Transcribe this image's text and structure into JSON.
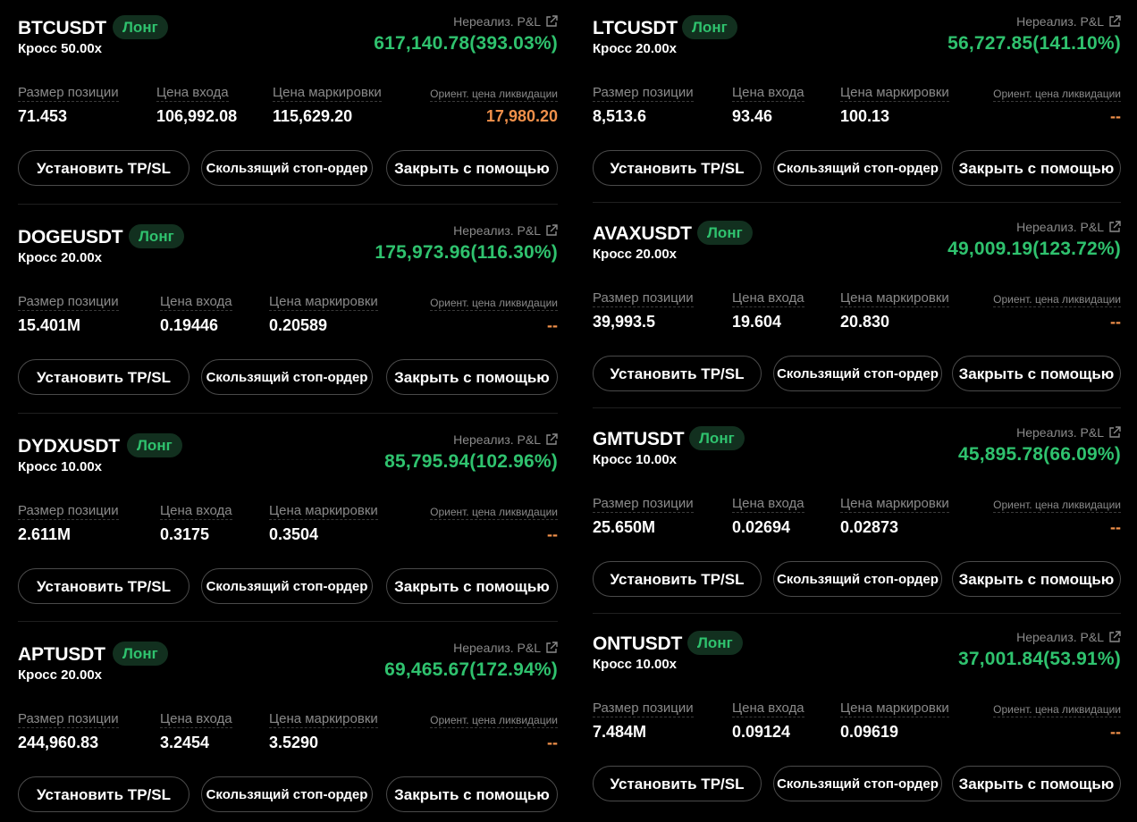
{
  "common": {
    "pnl_label": "Нереализ. P&L",
    "size_label": "Размер позиции",
    "entry_label": "Цена входа",
    "mark_label": "Цена маркировки",
    "liq_label": "Ориент. цена ликвидации",
    "btn_tpsl": "Установить TP/SL",
    "btn_trailing": "Скользящий стоп-ордер",
    "btn_close": "Закрыть с помощью",
    "colors": {
      "profit": "#2fc26e",
      "liq": "#f0904a",
      "badge_bg": "#12301f"
    }
  },
  "left": [
    {
      "symbol": "BTCUSDT",
      "side": "Лонг",
      "leverage": "Кросс 50.00x",
      "pnl": "617,140.78(393.03%)",
      "size": "71.453",
      "entry": "106,992.08",
      "mark": "115,629.20",
      "liq": "17,980.20"
    },
    {
      "symbol": "DOGEUSDT",
      "side": "Лонг",
      "leverage": "Кросс 20.00x",
      "pnl": "175,973.96(116.30%)",
      "size": "15.401M",
      "entry": "0.19446",
      "mark": "0.20589",
      "liq": "--"
    },
    {
      "symbol": "DYDXUSDT",
      "side": "Лонг",
      "leverage": "Кросс 10.00x",
      "pnl": "85,795.94(102.96%)",
      "size": "2.611M",
      "entry": "0.3175",
      "mark": "0.3504",
      "liq": "--"
    },
    {
      "symbol": "APTUSDT",
      "side": "Лонг",
      "leverage": "Кросс 20.00x",
      "pnl": "69,465.67(172.94%)",
      "size": "244,960.83",
      "entry": "3.2454",
      "mark": "3.5290",
      "liq": "--"
    }
  ],
  "right": [
    {
      "symbol": "LTCUSDT",
      "side": "Лонг",
      "leverage": "Кросс 20.00x",
      "pnl": "56,727.85(141.10%)",
      "size": "8,513.6",
      "entry": "93.46",
      "mark": "100.13",
      "liq": "--"
    },
    {
      "symbol": "AVAXUSDT",
      "side": "Лонг",
      "leverage": "Кросс 20.00x",
      "pnl": "49,009.19(123.72%)",
      "size": "39,993.5",
      "entry": "19.604",
      "mark": "20.830",
      "liq": "--"
    },
    {
      "symbol": "GMTUSDT",
      "side": "Лонг",
      "leverage": "Кросс 10.00x",
      "pnl": "45,895.78(66.09%)",
      "size": "25.650M",
      "entry": "0.02694",
      "mark": "0.02873",
      "liq": "--"
    },
    {
      "symbol": "ONTUSDT",
      "side": "Лонг",
      "leverage": "Кросс 10.00x",
      "pnl": "37,001.84(53.91%)",
      "size": "7.484M",
      "entry": "0.09124",
      "mark": "0.09619",
      "liq": "--"
    }
  ]
}
